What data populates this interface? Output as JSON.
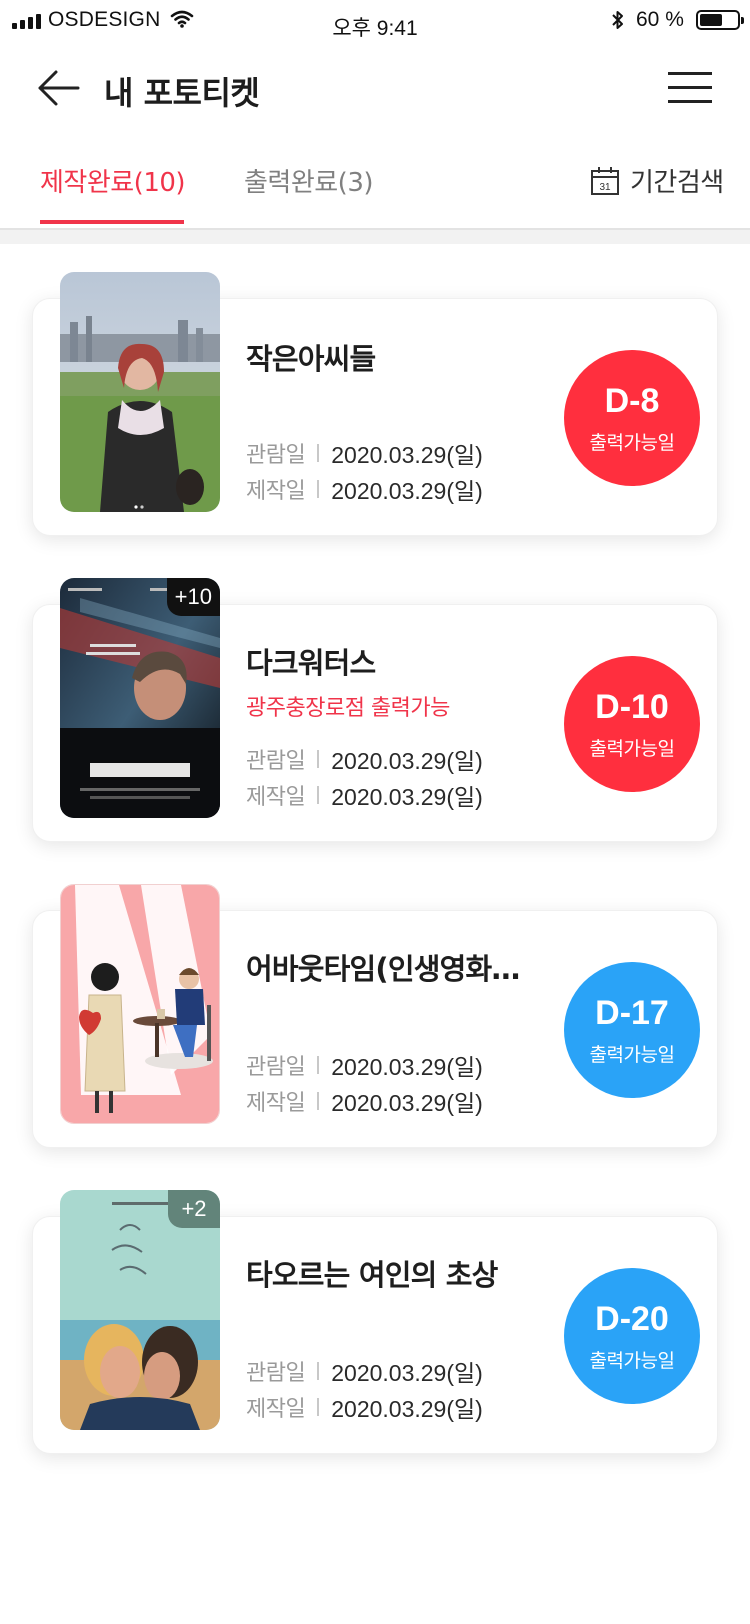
{
  "status_bar": {
    "carrier": "OSDESIGN",
    "time": "오후 9:41",
    "battery_text": "60 %",
    "battery_level": 0.6
  },
  "header": {
    "title": "내 포토티켓",
    "back_icon": "arrow-left-icon",
    "menu_icon": "hamburger-menu-icon"
  },
  "tabs": {
    "items": [
      {
        "label": "제작완료(10)",
        "active": true
      },
      {
        "label": "출력완료(3)",
        "active": false
      }
    ],
    "period_search": {
      "label": "기간검색",
      "icon": "calendar-icon",
      "icon_text": "31"
    }
  },
  "colors": {
    "accent": "#f0344a",
    "dday_red": "#ff2f3e",
    "dday_blue": "#2aa3f7"
  },
  "tickets": [
    {
      "title": "작은아씨들",
      "location": "",
      "more_count": "",
      "view_label": "관람일",
      "view_date": "2020.03.29(일)",
      "made_label": "제작일",
      "made_date": "2020.03.29(일)",
      "dday": "D-8",
      "dday_label": "출력가능일",
      "dday_color": "#ff2f3e"
    },
    {
      "title": "다크워터스",
      "location": "광주충장로점 출력가능",
      "more_count": "+10",
      "view_label": "관람일",
      "view_date": "2020.03.29(일)",
      "made_label": "제작일",
      "made_date": "2020.03.29(일)",
      "dday": "D-10",
      "dday_label": "출력가능일",
      "dday_color": "#ff2f3e"
    },
    {
      "title": "어바웃타임(인생영화…",
      "location": "",
      "more_count": "",
      "view_label": "관람일",
      "view_date": "2020.03.29(일)",
      "made_label": "제작일",
      "made_date": "2020.03.29(일)",
      "dday": "D-17",
      "dday_label": "출력가능일",
      "dday_color": "#2aa3f7"
    },
    {
      "title": "타오르는 여인의 초상",
      "location": "",
      "more_count": "+2",
      "view_label": "관람일",
      "view_date": "2020.03.29(일)",
      "made_label": "제작일",
      "made_date": "2020.03.29(일)",
      "dday": "D-20",
      "dday_label": "출력가능일",
      "dday_color": "#2aa3f7"
    }
  ]
}
